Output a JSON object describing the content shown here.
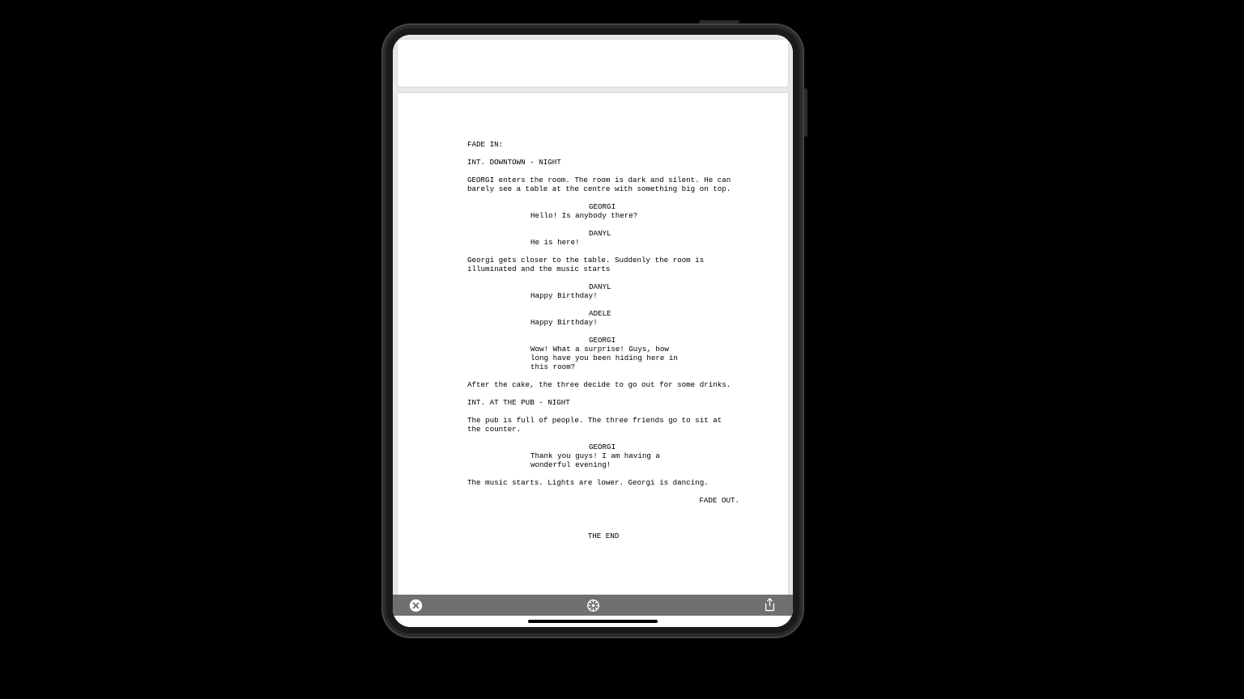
{
  "screenplay": {
    "fade_in": "FADE IN:",
    "scene1": "INT. DOWNTOWN - NIGHT",
    "action1": "GEORGI enters the room. The room is dark and silent. He can barely see a table at the centre with something big on top.",
    "char1": "GEORGI",
    "dialog1": "Hello! Is anybody there?",
    "char2": "DANYL",
    "dialog2": "He is here!",
    "action2": "Georgi gets closer to the table. Suddenly the room is illuminated and the music starts",
    "char3": "DANYL",
    "dialog3": "Happy Birthday!",
    "char4": "ADELE",
    "dialog4": "Happy Birthday!",
    "char5": "GEORGI",
    "dialog5": "Wow! What a surprise! Guys, how long have you been hiding here in this room?",
    "action3": "After the cake, the three decide to go out for some drinks.",
    "scene2": "INT. AT THE PUB - NIGHT",
    "action4": "The pub is full of people. The three friends go to sit at the counter.",
    "char6": "GEORGI",
    "dialog6": "Thank you guys! I am having a wonderful evening!",
    "action5": "The music starts. Lights are lower. Georgi is dancing.",
    "fade_out": "FADE OUT.",
    "the_end": "THE END"
  },
  "toolbar": {
    "close": "close-icon",
    "wheel": "settings-wheel-icon",
    "share": "share-icon"
  }
}
